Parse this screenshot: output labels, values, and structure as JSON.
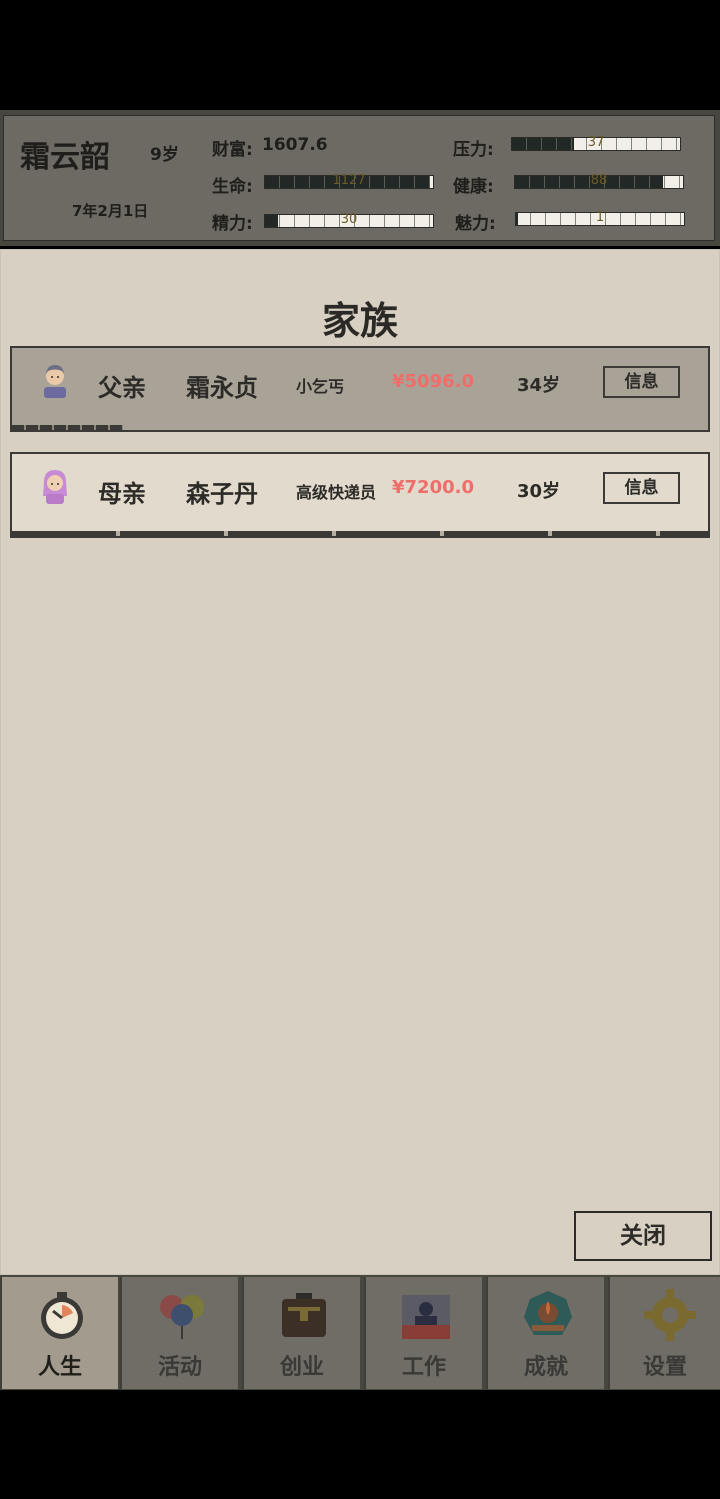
{
  "player": {
    "name": "霜云韶",
    "age": "9岁",
    "date": "7年2月1日",
    "wealth_label": "财富:",
    "wealth_value": "1607.6"
  },
  "stats": {
    "life": {
      "label": "生命:",
      "value": "1127",
      "level": 0.98
    },
    "energy": {
      "label": "精力:",
      "value": "30",
      "level": 0.08
    },
    "pressure": {
      "label": "压力:",
      "value": "37",
      "level": 0.37
    },
    "health": {
      "label": "健康:",
      "value": "88",
      "level": 0.88
    },
    "charm": {
      "label": "魅力:",
      "value": "1",
      "level": 0.01
    }
  },
  "dialog": {
    "title": "家族",
    "close_label": "关闭"
  },
  "family": [
    {
      "relation": "父亲",
      "name": "霜永贞",
      "job": "小乞丐",
      "money": "¥5096.0",
      "age": "34岁",
      "info_label": "信息",
      "avatar_icon": "male-avatar-icon",
      "progress": 0.16
    },
    {
      "relation": "母亲",
      "name": "森子丹",
      "job": "高级快递员",
      "money": "¥7200.0",
      "age": "30岁",
      "info_label": "信息",
      "avatar_icon": "female-avatar-icon",
      "progress": 1.0
    }
  ],
  "nav": [
    {
      "label": "人生",
      "icon": "stopwatch-icon",
      "active": true
    },
    {
      "label": "活动",
      "icon": "balloons-icon",
      "active": false
    },
    {
      "label": "创业",
      "icon": "briefcase-icon",
      "active": false
    },
    {
      "label": "工作",
      "icon": "worker-desk-icon",
      "active": false
    },
    {
      "label": "成就",
      "icon": "trophy-badge-icon",
      "active": false
    },
    {
      "label": "设置",
      "icon": "gear-icon",
      "active": false
    }
  ],
  "colors": {
    "money": "#ef6e6a",
    "dialog_bg": "#d8d0c2",
    "panel_bg": "#6c6a62"
  }
}
